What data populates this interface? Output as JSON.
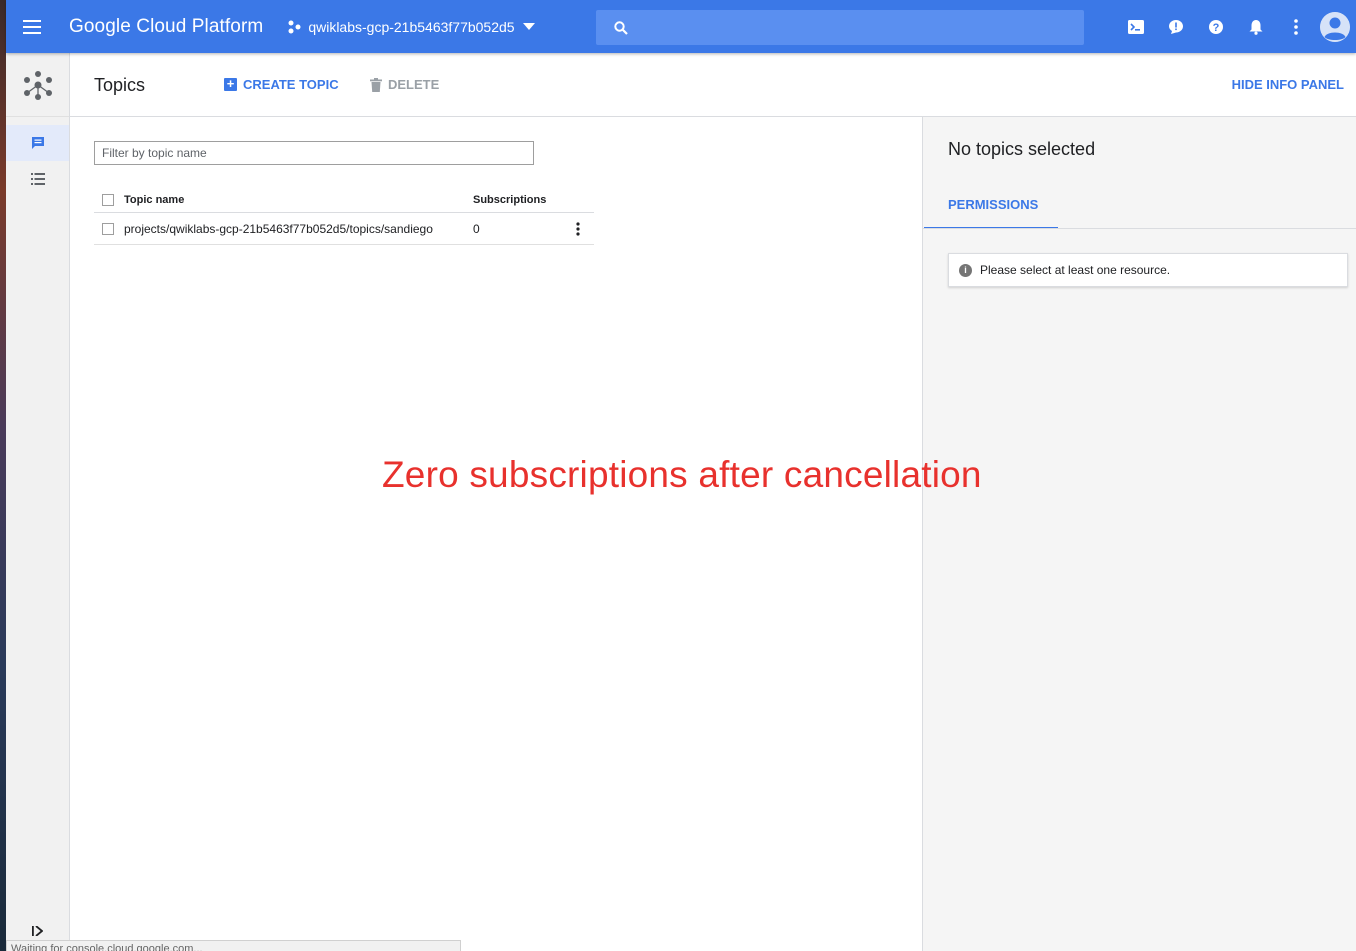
{
  "header": {
    "brand": "Google Cloud Platform",
    "project": "qwiklabs-gcp-21b5463f77b052d5"
  },
  "toolbar": {
    "title": "Topics",
    "create_label": "CREATE TOPIC",
    "delete_label": "DELETE",
    "hide_panel_label": "HIDE INFO PANEL"
  },
  "filter": {
    "placeholder": "Filter by topic name"
  },
  "table": {
    "columns": [
      "Topic name",
      "Subscriptions"
    ],
    "rows": [
      {
        "name": "projects/qwiklabs-gcp-21b5463f77b052d5/topics/sandiego",
        "subscriptions": "0"
      }
    ]
  },
  "annotation": "Zero subscriptions after cancellation",
  "info_panel": {
    "title": "No topics selected",
    "tab": "PERMISSIONS",
    "notice": "Please select at least one resource."
  },
  "status": "Waiting for console.cloud.google.com...",
  "colors": {
    "topbar": "#3b78e7",
    "accent": "#3b78e7",
    "annotation": "#e8312d"
  },
  "icons": [
    "menu-icon",
    "project-dots-icon",
    "caret-down-icon",
    "search-icon",
    "cloud-shell-icon",
    "feedback-icon",
    "help-icon",
    "notifications-icon",
    "more-vert-icon",
    "account-icon",
    "pubsub-logo-icon",
    "topics-icon",
    "subscriptions-icon",
    "expand-nav-icon",
    "trash-icon",
    "info-icon"
  ]
}
